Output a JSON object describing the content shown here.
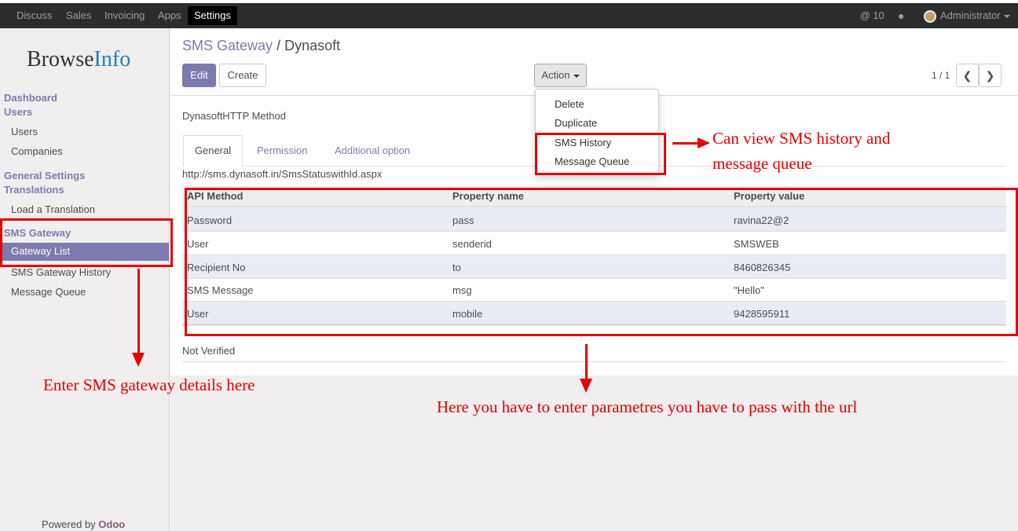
{
  "nav": {
    "items": [
      "Discuss",
      "Sales",
      "Invoicing",
      "Apps"
    ],
    "active": "Settings",
    "notifications": "10",
    "user": "Administrator"
  },
  "sidebar": {
    "logo_part1": "Browse",
    "logo_part2": "Info",
    "sections": {
      "dashboard": "Dashboard",
      "users": "Users",
      "users_item": "Users",
      "companies": "Companies",
      "general_settings": "General Settings",
      "translations": "Translations",
      "load_translation": "Load a Translation",
      "sms_gateway": "SMS Gateway",
      "gateway_list": "Gateway List",
      "sms_gateway_history": "SMS Gateway History",
      "message_queue": "Message Queue"
    },
    "powered_by": "Powered by",
    "powered_brand": "Odoo"
  },
  "control": {
    "breadcrumb_parent": "SMS Gateway",
    "breadcrumb_sep": "/",
    "breadcrumb_current": "Dynasoft",
    "edit_label": "Edit",
    "create_label": "Create",
    "action_label": "Action",
    "pager": "1 / 1"
  },
  "action_menu": [
    "Delete",
    "Duplicate",
    "SMS History",
    "Message Queue"
  ],
  "form": {
    "title": "DynasoftHTTP Method",
    "tabs": [
      "General",
      "Permission",
      "Additional option"
    ],
    "url": "http://sms.dynasoft.in/SmsStatuswithId.aspx",
    "columns": [
      "API Method",
      "Property name",
      "Property value"
    ],
    "rows": [
      [
        "Password",
        "pass",
        "ravina22@2"
      ],
      [
        "User",
        "senderid",
        "SMSWEB"
      ],
      [
        "Recipient No",
        "to",
        "8460826345"
      ],
      [
        "SMS Message",
        "msg",
        "\"Hello\""
      ],
      [
        "User",
        "mobile",
        "9428595911"
      ]
    ],
    "status": "Not Verified"
  },
  "annotations": {
    "history_line1": "Can view SMS history and",
    "history_line2": "message queue",
    "gateway_note": "Enter SMS gateway details here",
    "params_note": "Here you have to enter parametres you have to pass with the url"
  }
}
